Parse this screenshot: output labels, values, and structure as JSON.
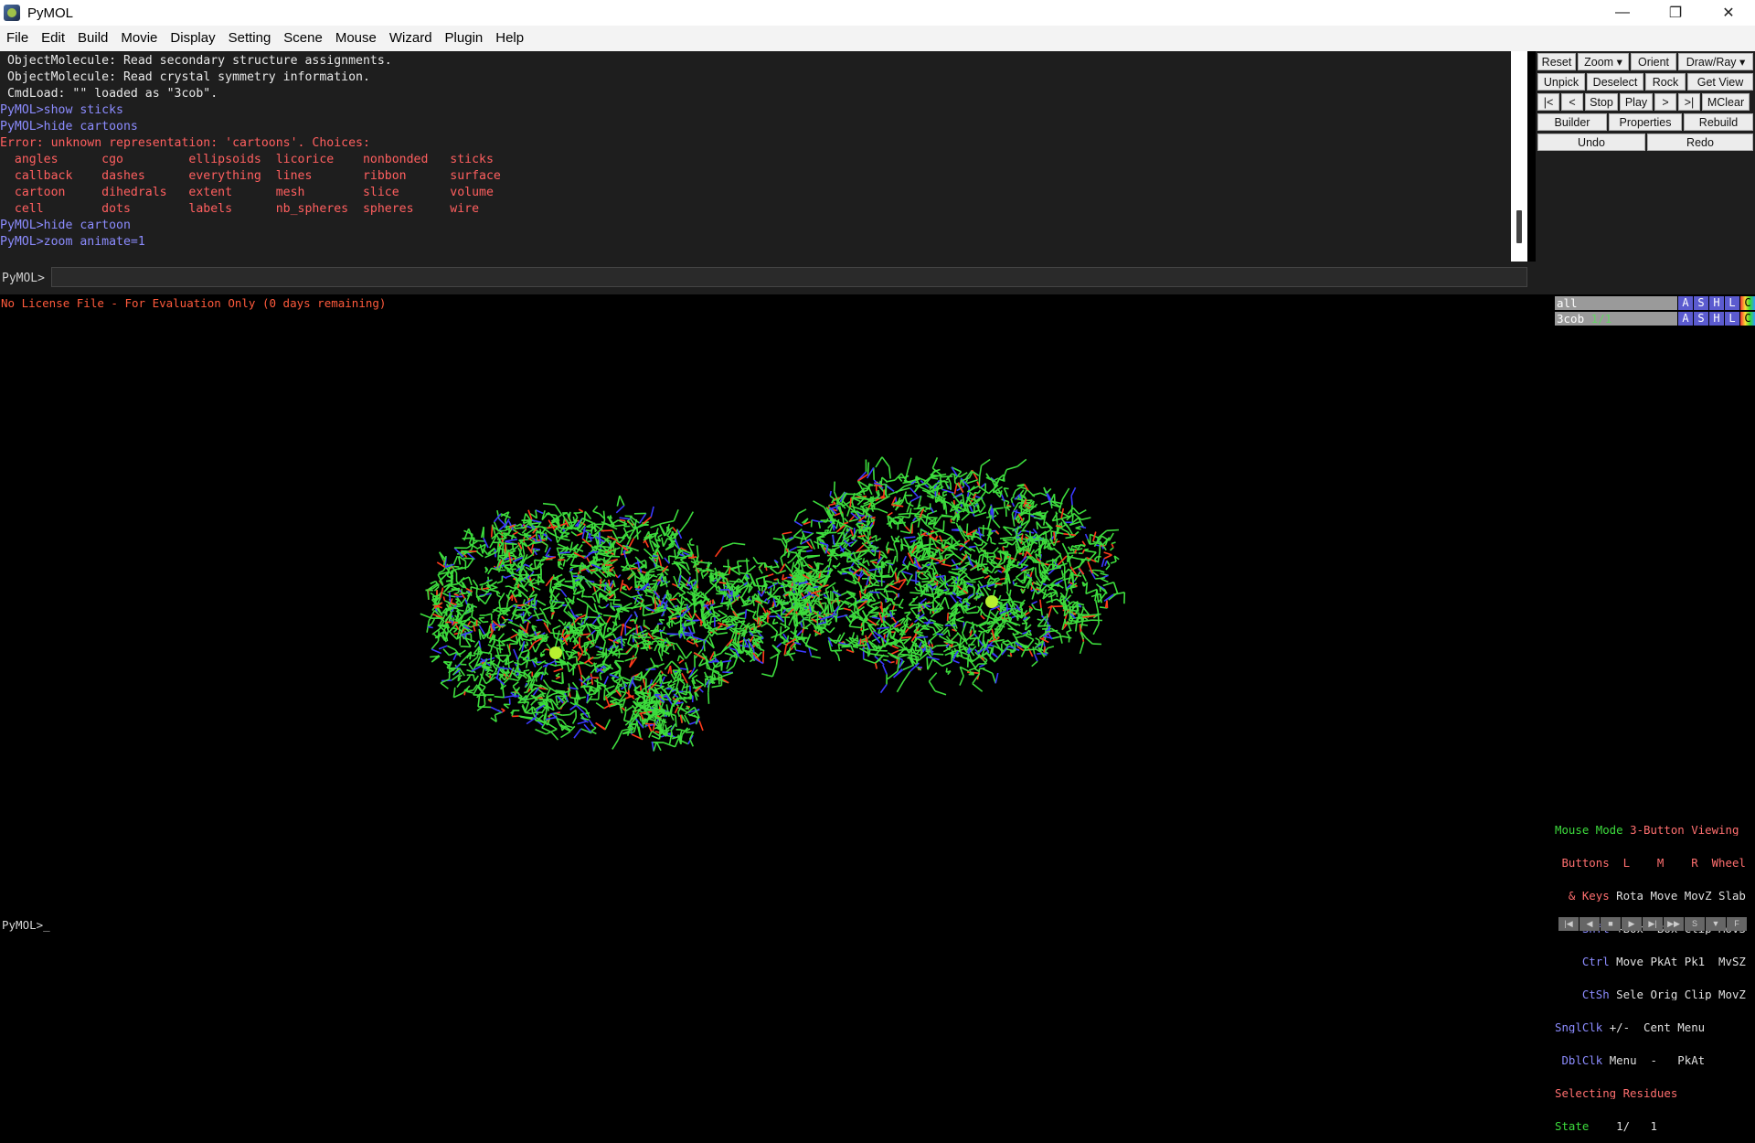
{
  "window": {
    "title": "PyMOL",
    "controls": [
      "minimize",
      "restore",
      "close"
    ]
  },
  "menu": [
    "File",
    "Edit",
    "Build",
    "Movie",
    "Display",
    "Setting",
    "Scene",
    "Mouse",
    "Wizard",
    "Plugin",
    "Help"
  ],
  "console": {
    "lines": [
      {
        "text": " ObjectMolecule: Read secondary structure assignments.",
        "kind": "white"
      },
      {
        "text": " ObjectMolecule: Read crystal symmetry information.",
        "kind": "white"
      },
      {
        "text": " CmdLoad: \"\" loaded as \"3cob\".",
        "kind": "white"
      },
      {
        "text": "PyMOL>show sticks",
        "kind": "prompt"
      },
      {
        "text": "PyMOL>hide cartoons",
        "kind": "prompt"
      },
      {
        "text": "Error: unknown representation: 'cartoons'. Choices:",
        "kind": "err"
      },
      {
        "text": "  angles      cgo         ellipsoids  licorice    nonbonded   sticks",
        "kind": "err"
      },
      {
        "text": "  callback    dashes      everything  lines       ribbon      surface",
        "kind": "err"
      },
      {
        "text": "  cartoon     dihedrals   extent      mesh        slice       volume",
        "kind": "err"
      },
      {
        "text": "  cell        dots        labels      nb_spheres  spheres     wire",
        "kind": "err"
      },
      {
        "text": "PyMOL>hide cartoon",
        "kind": "prompt"
      },
      {
        "text": "PyMOL>zoom animate=1",
        "kind": "prompt"
      }
    ]
  },
  "command": {
    "label": "PyMOL>",
    "value": ""
  },
  "buttons": {
    "row1": [
      "Reset",
      "Zoom ▾",
      "Orient",
      "Draw/Ray ▾"
    ],
    "row2": [
      "Unpick",
      "Deselect",
      "Rock",
      "Get View"
    ],
    "row3": [
      "|<",
      "<",
      "Stop",
      "Play",
      ">",
      ">|",
      "MClear"
    ],
    "row4": [
      "Builder",
      "Properties",
      "Rebuild"
    ],
    "row5": [
      "Undo",
      "Redo"
    ]
  },
  "viewport": {
    "license_notice": "No License File - For Evaluation Only (0 days remaining)"
  },
  "objects": [
    {
      "name": "all",
      "state": "",
      "buttons": [
        "A",
        "S",
        "H",
        "L",
        "C"
      ]
    },
    {
      "name": "3cob",
      "state": "1/1",
      "buttons": [
        "A",
        "S",
        "H",
        "L",
        "C"
      ]
    }
  ],
  "mouse_panel": {
    "line1a": "Mouse Mode ",
    "line1b": "3-Button Viewing",
    "line2": " Buttons  L    M    R  Wheel",
    "line3a": "  & Keys ",
    "line3b": "Rota Move MovZ Slab",
    "line4a": "    Shft ",
    "line4b": "+Box -Box Clip MovS",
    "line5a": "    Ctrl ",
    "line5b": "Move PkAt Pk1  MvSZ",
    "line6a": "    CtSh ",
    "line6b": "Sele Orig Clip MovZ",
    "line7a": "SnglClk ",
    "line7b": "+/-  Cent Menu",
    "line8a": " DblClk ",
    "line8b": "Menu  -   PkAt",
    "line9": "Selecting Residues",
    "line10a": "State ",
    "line10b": "   1/   1"
  },
  "status": {
    "text": "PyMOL>_"
  },
  "colors": {
    "carbon": "#3ddc3d",
    "nitrogen": "#3a3aff",
    "oxygen": "#ff3a1a",
    "ion": "#b8f030",
    "prompt": "#8c8cff",
    "error": "#ff5f5f"
  }
}
